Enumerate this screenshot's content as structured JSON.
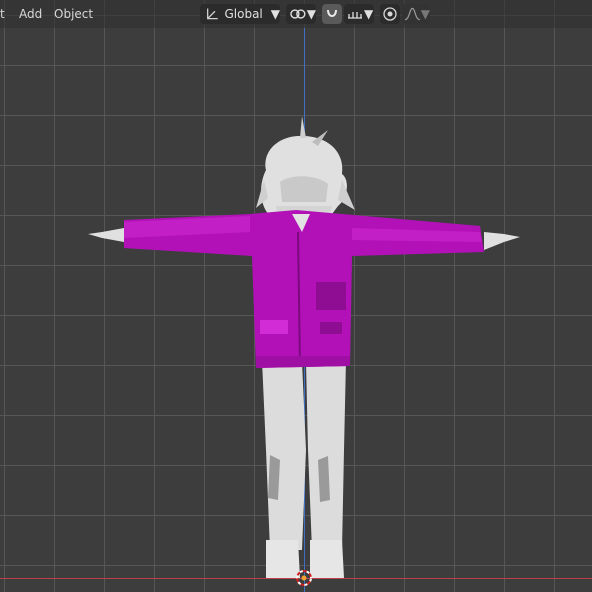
{
  "header": {
    "menus": [
      {
        "label": "t"
      },
      {
        "label": "Add"
      },
      {
        "label": "Object"
      }
    ],
    "transform_orientation": {
      "value": "Global"
    },
    "snap_target_icon": "link-pivot-icon",
    "snap_icon": "magnet-icon",
    "snap_increment_icon": "increment-snap-icon",
    "proportional_edit_icon": "proportional-edit-icon",
    "falloff_icon": "falloff-curve-icon"
  },
  "colors": {
    "viewport_bg": "#3d3d3d",
    "grid": "#5a5a5a",
    "axis_x": "#b8414c",
    "axis_y": "#3f6ec4",
    "jacket": "#b311b8",
    "body": "#d9d9d9"
  }
}
